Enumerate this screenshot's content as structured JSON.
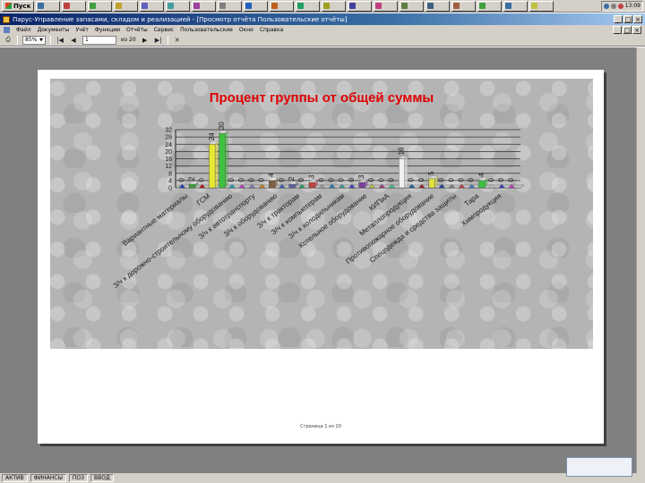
{
  "taskbar": {
    "start_label": "Пуск",
    "buttons": [
      {
        "label": "",
        "color": "#3a6ea5"
      },
      {
        "label": "",
        "color": "#c04040"
      },
      {
        "label": "",
        "color": "#40a040"
      },
      {
        "label": "",
        "color": "#c0a030"
      },
      {
        "label": "",
        "color": "#6060c0"
      },
      {
        "label": "",
        "color": "#40a0a0"
      },
      {
        "label": "",
        "color": "#a040a0"
      },
      {
        "label": "",
        "color": "#808080"
      },
      {
        "label": "",
        "color": "#2060c0"
      },
      {
        "label": "",
        "color": "#c06020"
      },
      {
        "label": "",
        "color": "#20a060"
      },
      {
        "label": "",
        "color": "#a0a020"
      },
      {
        "label": "",
        "color": "#4040a0"
      },
      {
        "label": "",
        "color": "#c04080"
      },
      {
        "label": "",
        "color": "#608040"
      },
      {
        "label": "",
        "color": "#406080"
      },
      {
        "label": "",
        "color": "#a06040"
      },
      {
        "label": "",
        "color": "#40a040"
      },
      {
        "label": "",
        "color": "#3a6ea5"
      },
      {
        "label": "",
        "color": "#c0c040"
      }
    ],
    "clock": "13:09"
  },
  "window": {
    "title": "Парус-Управление запасами, складом и реализацией - [Просмотр отчёта Пользовательские отчёты]",
    "minimize": "_",
    "maximize": "□",
    "close": "×"
  },
  "menu": {
    "items": [
      "Файл",
      "Документы",
      "Учёт",
      "Функции",
      "Отчёты",
      "Сервис",
      "Пользовательские",
      "Окно",
      "Справка"
    ]
  },
  "toolbar": {
    "zoom": "85%",
    "page": "1",
    "page_total": "из 20",
    "buttons": {
      "print": "⎙",
      "first": "|◀",
      "prev": "◀",
      "next": "▶",
      "last": "▶|",
      "close": "✕"
    }
  },
  "page": {
    "footer": "Страница 1 из 20"
  },
  "status": {
    "cells": [
      "АКТИВ",
      "ФИНАНСЫ",
      "ПОЗ",
      "ВВОД"
    ]
  },
  "popup": {
    "text": ""
  },
  "chart_data": {
    "type": "bar",
    "title": "Процент группы от общей суммы",
    "xlabel": "",
    "ylabel": "",
    "ylim": [
      0,
      32
    ],
    "yticks": [
      0,
      4,
      8,
      12,
      16,
      20,
      24,
      28,
      32
    ],
    "categories": [
      "Вариантные материалы",
      "ГСМ",
      "З/ч к дорожно-строительному оборудованию",
      "З/ч к автотранспорту",
      "З/ч к оборудованию",
      "З/ч к тракторам",
      "З/ч к компьютерам",
      "З/ч к холодильникам",
      "Котельное оборудование",
      "КИПиА",
      "Металлопродукция",
      "Противопожарное оборудование",
      "Спецодежда и средства защиты",
      "Тара",
      "Химпродукция"
    ],
    "bars": [
      {
        "value": 0,
        "color": "#2040c0"
      },
      {
        "value": 2,
        "color": "#40a040"
      },
      {
        "value": 0,
        "color": "#c02020"
      },
      {
        "value": 24,
        "color": "#e8e830"
      },
      {
        "value": 30,
        "color": "#40c040"
      },
      {
        "value": 0,
        "color": "#20a0c0"
      },
      {
        "value": 0,
        "color": "#c040c0"
      },
      {
        "value": 0,
        "color": "#8080c0"
      },
      {
        "value": 0,
        "color": "#c08020"
      },
      {
        "value": 4,
        "color": "#806040"
      },
      {
        "value": 0,
        "color": "#4060c0"
      },
      {
        "value": 2,
        "color": "#6060a0"
      },
      {
        "value": 0,
        "color": "#20a060"
      },
      {
        "value": 3,
        "color": "#c04040"
      },
      {
        "value": 0,
        "color": "#a0a0a0"
      },
      {
        "value": 0,
        "color": "#2080c0"
      },
      {
        "value": 0,
        "color": "#40a0a0"
      },
      {
        "value": 0,
        "color": "#4040c0"
      },
      {
        "value": 3,
        "color": "#8040a0"
      },
      {
        "value": 0,
        "color": "#c0c040"
      },
      {
        "value": 0,
        "color": "#a04080"
      },
      {
        "value": 0,
        "color": "#40c080"
      },
      {
        "value": 16,
        "color": "#f0f0f0"
      },
      {
        "value": 0,
        "color": "#2060a0"
      },
      {
        "value": 0,
        "color": "#a02020"
      },
      {
        "value": 5,
        "color": "#e0e040"
      },
      {
        "value": 0,
        "color": "#2040a0"
      },
      {
        "value": 0,
        "color": "#808080"
      },
      {
        "value": 0,
        "color": "#c04040"
      },
      {
        "value": 0,
        "color": "#4080c0"
      },
      {
        "value": 4,
        "color": "#40c040"
      },
      {
        "value": 0,
        "color": "#c0c0c0"
      },
      {
        "value": 0,
        "color": "#4040c0"
      },
      {
        "value": 0,
        "color": "#c040c0"
      }
    ],
    "grid": true,
    "legend": "none"
  }
}
